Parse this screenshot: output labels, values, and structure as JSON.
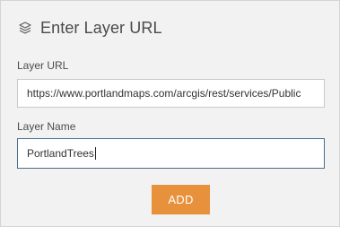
{
  "header": {
    "title": "Enter Layer URL",
    "icon": "layers-icon"
  },
  "form": {
    "url_label": "Layer URL",
    "url_value": "https://www.portlandmaps.com/arcgis/rest/services/Public",
    "name_label": "Layer Name",
    "name_value": "PortlandTrees"
  },
  "actions": {
    "add_label": "ADD"
  },
  "colors": {
    "panel_bg": "#f2f2f2",
    "accent_button": "#e8913c",
    "focused_border": "#4a6d8c"
  }
}
